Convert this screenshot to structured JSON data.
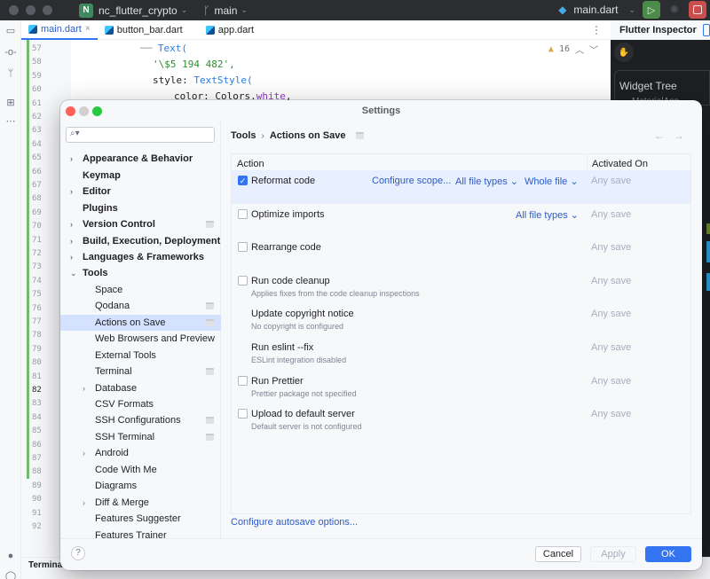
{
  "titlebar": {
    "project_badge": "N",
    "project_name": "nc_flutter_crypto",
    "branch": "main",
    "run_config": "main.dart"
  },
  "editor": {
    "tabs": [
      {
        "label": "main.dart",
        "active": true
      },
      {
        "label": "button_bar.dart",
        "active": false
      },
      {
        "label": "app.dart",
        "active": false
      }
    ],
    "warnings_count": "16",
    "line_numbers": [
      "57",
      "58",
      "59",
      "60",
      "61",
      "62",
      "63",
      "64",
      "65",
      "66",
      "67",
      "68",
      "69",
      "70",
      "71",
      "72",
      "73",
      "74",
      "75",
      "76",
      "77",
      "78",
      "79",
      "80",
      "81",
      "82",
      "83",
      "84",
      "85",
      "86",
      "87",
      "88",
      "89",
      "90",
      "91",
      "92"
    ],
    "current_line": "82",
    "code": {
      "l57_type": "Text(",
      "l58_str": "'\\$5 194 482',",
      "l59_prefix": "style: ",
      "l59_type": "TextStyle(",
      "l60_prefix": "color: Colors.",
      "l60_prop": "white",
      "l60_suffix": ","
    }
  },
  "inspector": {
    "title": "Flutter Inspector",
    "widget_tree": "Widget Tree",
    "root": "MaterialApp"
  },
  "bottom": {
    "terminal_tab": "Terminal"
  },
  "dialog": {
    "title": "Settings",
    "search_placeholder": "",
    "nav": [
      {
        "label": "Appearance & Behavior",
        "level": 0,
        "expandable": true,
        "bold": true
      },
      {
        "label": "Keymap",
        "level": 0,
        "expandable": false,
        "bold": true
      },
      {
        "label": "Editor",
        "level": 0,
        "expandable": true,
        "bold": true
      },
      {
        "label": "Plugins",
        "level": 0,
        "expandable": false,
        "bold": true
      },
      {
        "label": "Version Control",
        "level": 0,
        "expandable": true,
        "bold": true,
        "project": true
      },
      {
        "label": "Build, Execution, Deployment",
        "level": 0,
        "expandable": true,
        "bold": true
      },
      {
        "label": "Languages & Frameworks",
        "level": 0,
        "expandable": true,
        "bold": true
      },
      {
        "label": "Tools",
        "level": 0,
        "expanded": true,
        "bold": true
      },
      {
        "label": "Space",
        "level": 1
      },
      {
        "label": "Qodana",
        "level": 1,
        "project": true
      },
      {
        "label": "Actions on Save",
        "level": 1,
        "project": true,
        "selected": true
      },
      {
        "label": "Web Browsers and Preview",
        "level": 1
      },
      {
        "label": "External Tools",
        "level": 1
      },
      {
        "label": "Terminal",
        "level": 1,
        "project": true
      },
      {
        "label": "Database",
        "level": 1,
        "expandable": true
      },
      {
        "label": "CSV Formats",
        "level": 1
      },
      {
        "label": "SSH Configurations",
        "level": 1,
        "project": true
      },
      {
        "label": "SSH Terminal",
        "level": 1,
        "project": true
      },
      {
        "label": "Android",
        "level": 1,
        "expandable": true
      },
      {
        "label": "Code With Me",
        "level": 1
      },
      {
        "label": "Diagrams",
        "level": 1
      },
      {
        "label": "Diff & Merge",
        "level": 1,
        "expandable": true
      },
      {
        "label": "Features Suggester",
        "level": 1
      },
      {
        "label": "Features Trainer",
        "level": 1
      }
    ],
    "breadcrumb": {
      "parent": "Tools",
      "separator": "›",
      "current": "Actions on Save"
    },
    "table": {
      "headers": {
        "action": "Action",
        "activated_on": "Activated On"
      },
      "rows": [
        {
          "title": "Reformat code",
          "subtitle": "",
          "checkbox": true,
          "checked": true,
          "links": [
            "Configure scope...",
            "All file types ⌄",
            "Whole file ⌄"
          ],
          "activated_on": "Any save"
        },
        {
          "title": "Optimize imports",
          "subtitle": "",
          "checkbox": true,
          "checked": false,
          "links": [
            "All file types ⌄"
          ],
          "activated_on": "Any save"
        },
        {
          "title": "Rearrange code",
          "subtitle": "",
          "checkbox": true,
          "checked": false,
          "links": [],
          "activated_on": "Any save"
        },
        {
          "title": "Run code cleanup",
          "subtitle": "Applies fixes from the code cleanup inspections",
          "checkbox": true,
          "checked": false,
          "links": [],
          "activated_on": "Any save"
        },
        {
          "title": "Update copyright notice",
          "subtitle": "No copyright is configured",
          "checkbox": false,
          "checked": false,
          "links": [],
          "activated_on": "Any save"
        },
        {
          "title": "Run eslint --fix",
          "subtitle": "ESLint integration disabled",
          "checkbox": false,
          "checked": false,
          "links": [],
          "activated_on": "Any save"
        },
        {
          "title": "Run Prettier",
          "subtitle": "Prettier package not specified",
          "checkbox": true,
          "checked": false,
          "links": [],
          "activated_on": "Any save"
        },
        {
          "title": "Upload to default server",
          "subtitle": "Default server is not configured",
          "checkbox": true,
          "checked": false,
          "links": [],
          "activated_on": "Any save"
        }
      ]
    },
    "autosave_link": "Configure autosave options...",
    "buttons": {
      "help": "?",
      "cancel": "Cancel",
      "apply": "Apply",
      "ok": "OK"
    }
  },
  "colors": {
    "accent": "#3574f0",
    "link": "#2d5cc9",
    "selection": "#d4e2ff",
    "close": "#ff5f57",
    "minimize": "#d0d0d0",
    "maximize": "#28c840"
  }
}
